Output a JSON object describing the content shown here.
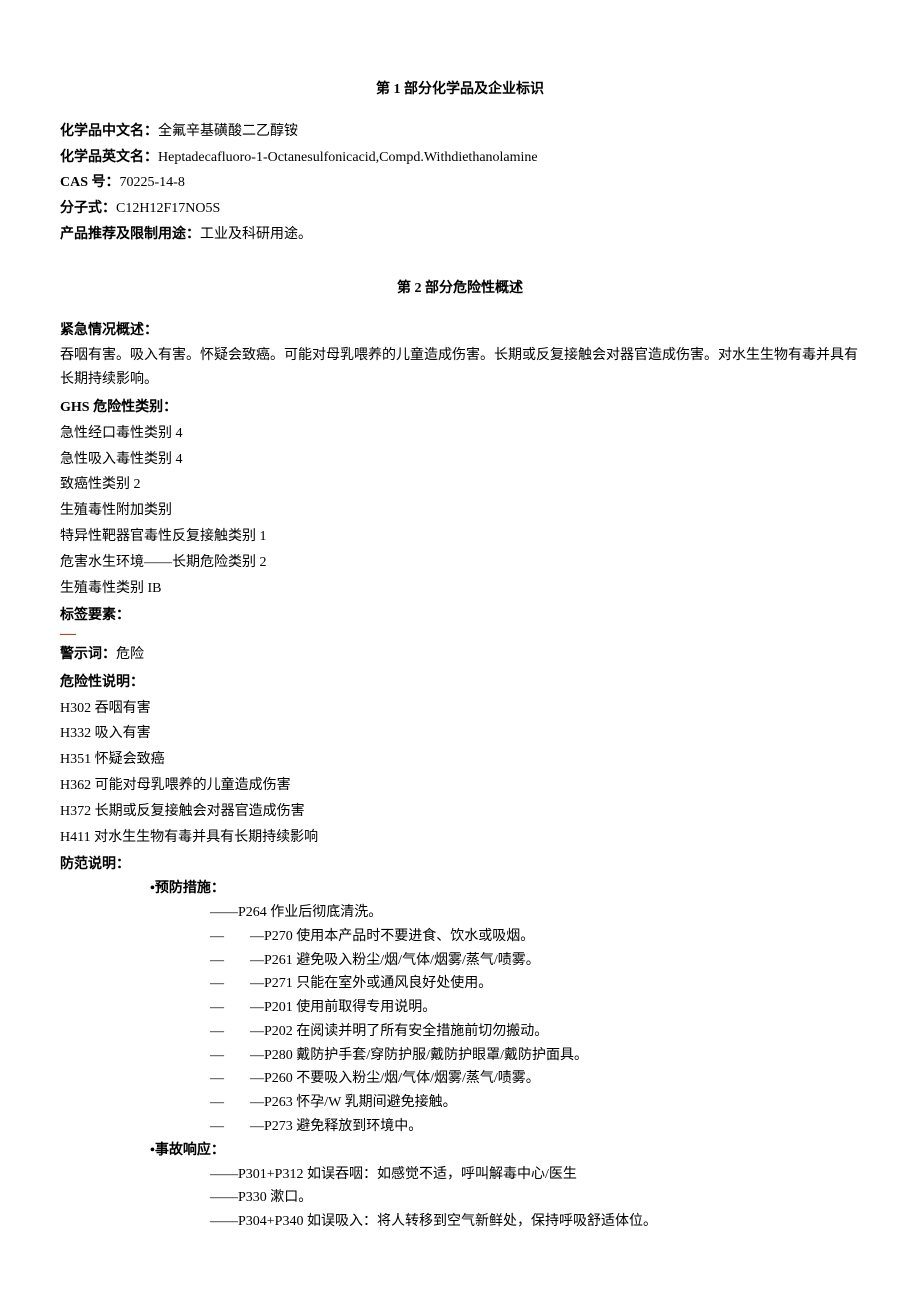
{
  "section1": {
    "heading": "第 1 部分化学品及企业标识",
    "name_cn_label": "化学品中文名：",
    "name_cn_value": "全氟辛基磺酸二乙醇铵",
    "name_en_label": "化学品英文名：",
    "name_en_value": "Heptadecafluoro-1-Octanesulfonicacid,Compd.Withdiethanolamine",
    "cas_label": "CAS 号：",
    "cas_value": "70225-14-8",
    "formula_label": "分子式：",
    "formula_value": "C12H12F17NO5S",
    "use_label": "产品推荐及限制用途：",
    "use_value": "工业及科研用途。"
  },
  "section2": {
    "heading": "第 2 部分危险性概述",
    "emergency_label": "紧急情况概述：",
    "emergency_text": "吞咽有害。吸入有害。怀疑会致癌。可能对母乳喂养的儿童造成伤害。长期或反复接触会对器官造成伤害。对水生生物有毒并具有长期持续影响。",
    "ghs_label": "GHS 危险性类别：",
    "ghs_items": [
      "急性经口毒性类别 4",
      "急性吸入毒性类别 4",
      "致癌性类别 2",
      "生殖毒性附加类别",
      "特异性靶器官毒性反复接触类别 1",
      "危害水生环境——长期危险类别 2",
      "生殖毒性类别 IB"
    ],
    "label_elements_label": "标签要素：",
    "dash": "—",
    "signal_label": "警示词：",
    "signal_value": "危险",
    "hazard_label": "危险性说明：",
    "hazard_items": [
      "H302 吞咽有害",
      "H332 吸入有害",
      "H351 怀疑会致癌",
      "H362 可能对母乳喂养的儿童造成伤害",
      "H372 长期或反复接触会对器官造成伤害",
      "H411 对水生生物有毒并具有长期持续影响"
    ],
    "precaution_label": "防范说明：",
    "prevention_head": "•预防措施：",
    "prevention_first": "——P264 作业后彻底清洗。",
    "prevention_items": [
      "—P270 使用本产品时不要进食、饮水或吸烟。",
      "—P261 避免吸入粉尘/烟/气体/烟雾/蒸气/啧雾。",
      "—P271 只能在室外或通风良好处使用。",
      "—P201 使用前取得专用说明。",
      "—P202 在阅读并明了所有安全措施前切勿搬动。",
      "—P280 戴防护手套/穿防护服/戴防护眼罩/戴防护面具。",
      "—P260 不要吸入粉尘/烟/气体/烟雾/蒸气/啧雾。",
      "—P263 怀孕/W 乳期间避免接触。",
      "—P273 避免释放到环境中。"
    ],
    "response_head": "•事故响应：",
    "response_items": [
      "——P301+P312 如误吞咽：如感觉不适，呼叫解毒中心/医生",
      "——P330 漱口。",
      "——P304+P340 如误吸入：将人转移到空气新鲜处，保持呼吸舒适体位。"
    ],
    "dash_sep": "—"
  }
}
